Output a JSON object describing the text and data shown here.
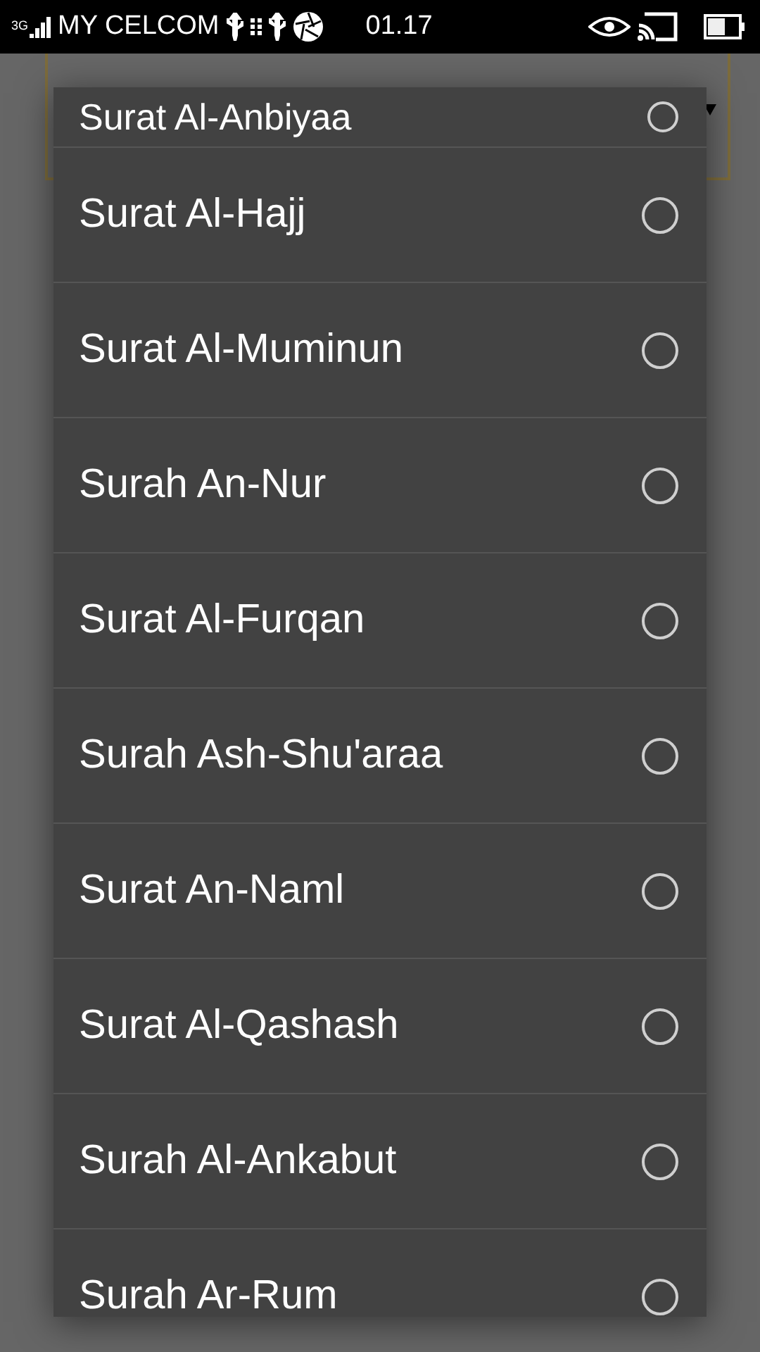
{
  "status_bar": {
    "network_type": "3G",
    "carrier": "MY CELCOM",
    "time": "01.17"
  },
  "dialog": {
    "options": [
      {
        "label": "Surat Al-Anbiyaa",
        "selected": false
      },
      {
        "label": "Surat Al-Hajj",
        "selected": false
      },
      {
        "label": "Surat Al-Muminun",
        "selected": false
      },
      {
        "label": "Surah An-Nur",
        "selected": false
      },
      {
        "label": "Surat Al-Furqan",
        "selected": false
      },
      {
        "label": "Surah Ash-Shu'araa",
        "selected": false
      },
      {
        "label": "Surat An-Naml",
        "selected": false
      },
      {
        "label": "Surat Al-Qashash",
        "selected": false
      },
      {
        "label": "Surah Al-Ankabut",
        "selected": false
      },
      {
        "label": "Surah Ar-Rum",
        "selected": false
      }
    ]
  }
}
